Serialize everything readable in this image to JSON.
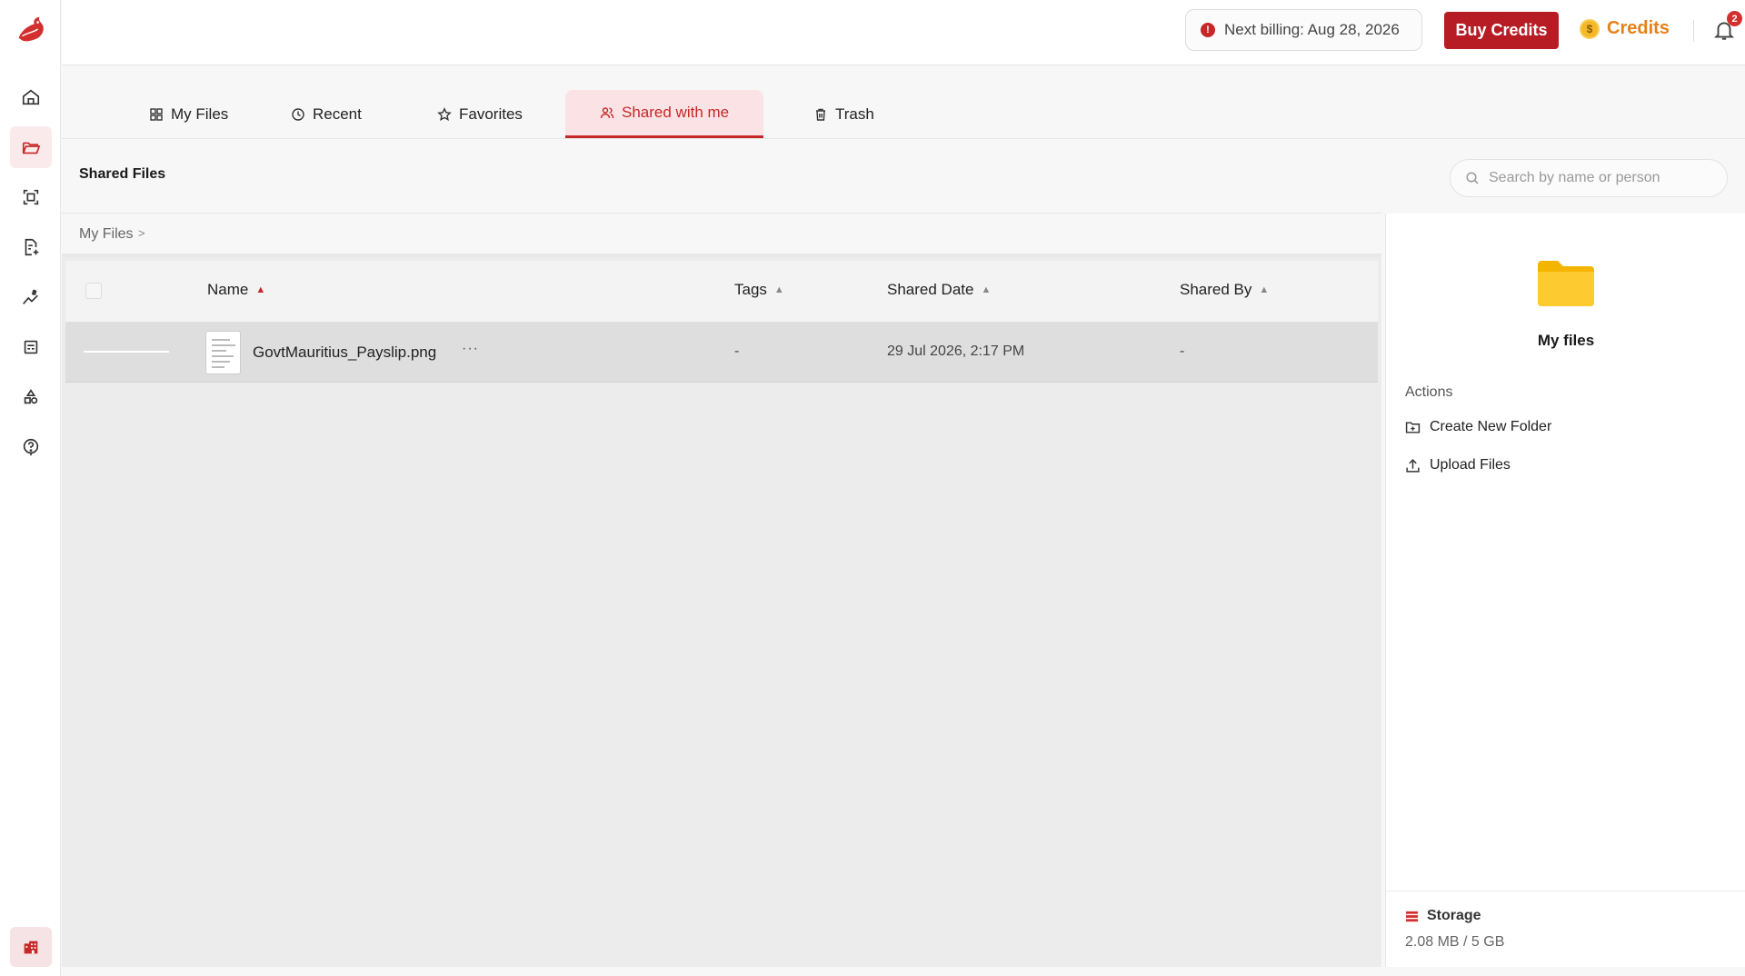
{
  "topbar": {
    "billing_text": "Next billing: Aug 28, 2026",
    "buy_credits_label": "Buy Credits",
    "credits_label": "Credits",
    "notification_count": "2"
  },
  "tabs": [
    {
      "label": "My Files",
      "icon": "grid-icon"
    },
    {
      "label": "Recent",
      "icon": "clock-icon"
    },
    {
      "label": "Favorites",
      "icon": "star-icon"
    },
    {
      "label": "Shared with me",
      "icon": "users-icon",
      "active": true
    },
    {
      "label": "Trash",
      "icon": "trash-icon"
    }
  ],
  "header": {
    "title": "Shared Files",
    "search_placeholder": "Search by name or person"
  },
  "breadcrumb": {
    "root": "My Files"
  },
  "table": {
    "columns": [
      "Name",
      "Tags",
      "Shared Date",
      "Shared By"
    ],
    "rows": [
      {
        "name": "GovtMauritius_Payslip.png",
        "more": "···",
        "tags": "-",
        "shared_date": "29 Jul 2026, 2:17 PM",
        "shared_by": "-"
      }
    ]
  },
  "panel": {
    "folder_name": "My files",
    "actions_label": "Actions",
    "actions": [
      "Create New Folder",
      "Upload Files"
    ],
    "storage_label": "Storage",
    "storage_value": "2.08 MB / 5 GB"
  },
  "colors": {
    "accent": "#c62828",
    "credits": "#e8801a",
    "folder": "#fbc02d"
  }
}
